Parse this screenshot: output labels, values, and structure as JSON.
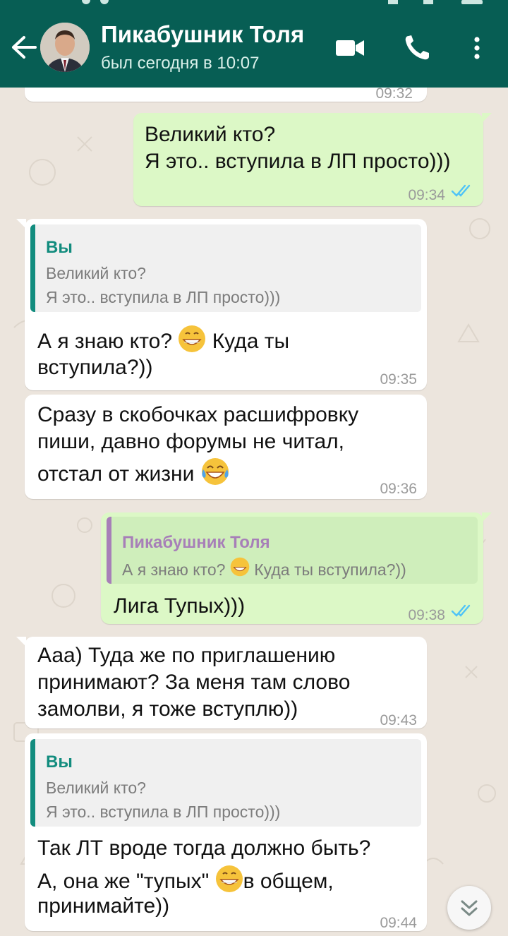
{
  "header": {
    "contact_name": "Пикабушник Толя",
    "status": "был сегодня в 10:07"
  },
  "colors": {
    "header": "#075e54",
    "outgoing": "#dcf8c6",
    "incoming": "#ffffff",
    "read_ticks": "#4fc3f7"
  },
  "icons": [
    "back-arrow-icon",
    "video-call-icon",
    "phone-icon",
    "more-vert-icon",
    "scroll-down-icon"
  ],
  "messages": [
    {
      "id": "m0",
      "time": "09:32"
    },
    {
      "id": "m1",
      "lines": [
        "Великий кто?",
        "Я это.. вступила в ЛП просто)))"
      ],
      "time": "09:34"
    },
    {
      "id": "m2",
      "reply": {
        "name": "Вы",
        "lines": [
          "Великий кто?",
          "Я это.. вступила в ЛП просто)))"
        ]
      },
      "lines": [
        "А я знаю кто?",
        "Куда ты",
        "вступила?))"
      ],
      "time": "09:35"
    },
    {
      "id": "m3",
      "lines": [
        "Сразу в скобочках расшифровку",
        "пиши, давно форумы не читал,",
        "отстал от жизни"
      ],
      "time": "09:36"
    },
    {
      "id": "m4",
      "reply": {
        "name": "Пикабушник Толя",
        "line_a": "А я знаю кто?",
        "line_b": "Куда ты вступила?))"
      },
      "lines": [
        "Лига Тупых)))"
      ],
      "time": "09:38"
    },
    {
      "id": "m5",
      "lines": [
        "Ааа) Туда же по приглашению",
        "принимают? За меня там слово",
        "замолви, я тоже вступлю))"
      ],
      "time": "09:43"
    },
    {
      "id": "m6",
      "reply": {
        "name": "Вы",
        "lines": [
          "Великий кто?",
          "Я это.. вступила в ЛП просто)))"
        ]
      },
      "lines": [
        "Так ЛТ вроде тогда должно быть?",
        "А, она же \"тупых\"",
        "в общем,",
        "принимайте))"
      ],
      "time": "09:44"
    }
  ]
}
